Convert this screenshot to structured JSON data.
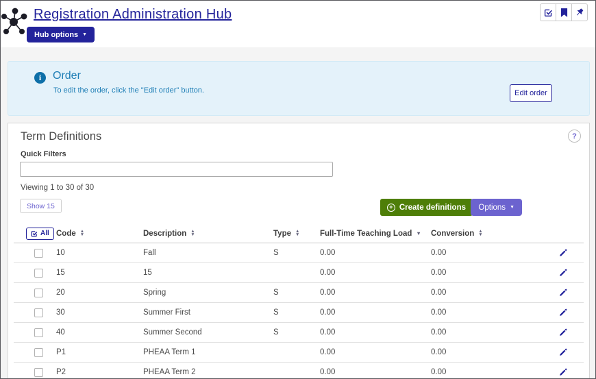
{
  "header": {
    "title": "Registration Administration Hub",
    "hub_options_label": "Hub options",
    "toolbar_icons": [
      "check-square-icon",
      "bookmark-icon",
      "pin-icon"
    ]
  },
  "order_panel": {
    "title": "Order",
    "description": "To edit the order, click the \"Edit order\" button.",
    "edit_button_label": "Edit order"
  },
  "term_definitions": {
    "title": "Term Definitions",
    "help_label": "?",
    "quick_filters_label": "Quick Filters",
    "filter_value": "",
    "viewing_text": "Viewing 1 to 30 of 30",
    "show_button_label": "Show 15",
    "create_button_label": "Create definitions",
    "options_button_label": "Options",
    "table": {
      "select_all_label": "All",
      "columns": [
        {
          "label": "Code",
          "sort": "both"
        },
        {
          "label": "Description",
          "sort": "both"
        },
        {
          "label": "Type",
          "sort": "both"
        },
        {
          "label": "Full-Time Teaching Load",
          "sort": "desc"
        },
        {
          "label": "Conversion",
          "sort": "both"
        }
      ],
      "rows": [
        {
          "code": "10",
          "description": "Fall",
          "type": "S",
          "full_time_teaching_load": "0.00",
          "conversion": "0.00"
        },
        {
          "code": "15",
          "description": "15",
          "type": "",
          "full_time_teaching_load": "0.00",
          "conversion": "0.00"
        },
        {
          "code": "20",
          "description": "Spring",
          "type": "S",
          "full_time_teaching_load": "0.00",
          "conversion": "0.00"
        },
        {
          "code": "30",
          "description": "Summer First",
          "type": "S",
          "full_time_teaching_load": "0.00",
          "conversion": "0.00"
        },
        {
          "code": "40",
          "description": "Summer Second",
          "type": "S",
          "full_time_teaching_load": "0.00",
          "conversion": "0.00"
        },
        {
          "code": "P1",
          "description": "PHEAA Term 1",
          "type": "",
          "full_time_teaching_load": "0.00",
          "conversion": "0.00"
        },
        {
          "code": "P2",
          "description": "PHEAA Term 2",
          "type": "",
          "full_time_teaching_load": "0.00",
          "conversion": "0.00"
        }
      ]
    }
  },
  "colors": {
    "brand_navy": "#23239b",
    "accent_purple": "#6c63cf",
    "accent_green": "#4e7e08",
    "info_blue": "#1d7db5",
    "info_bg": "#e4f2fa",
    "page_bg": "#f4f4f4"
  }
}
